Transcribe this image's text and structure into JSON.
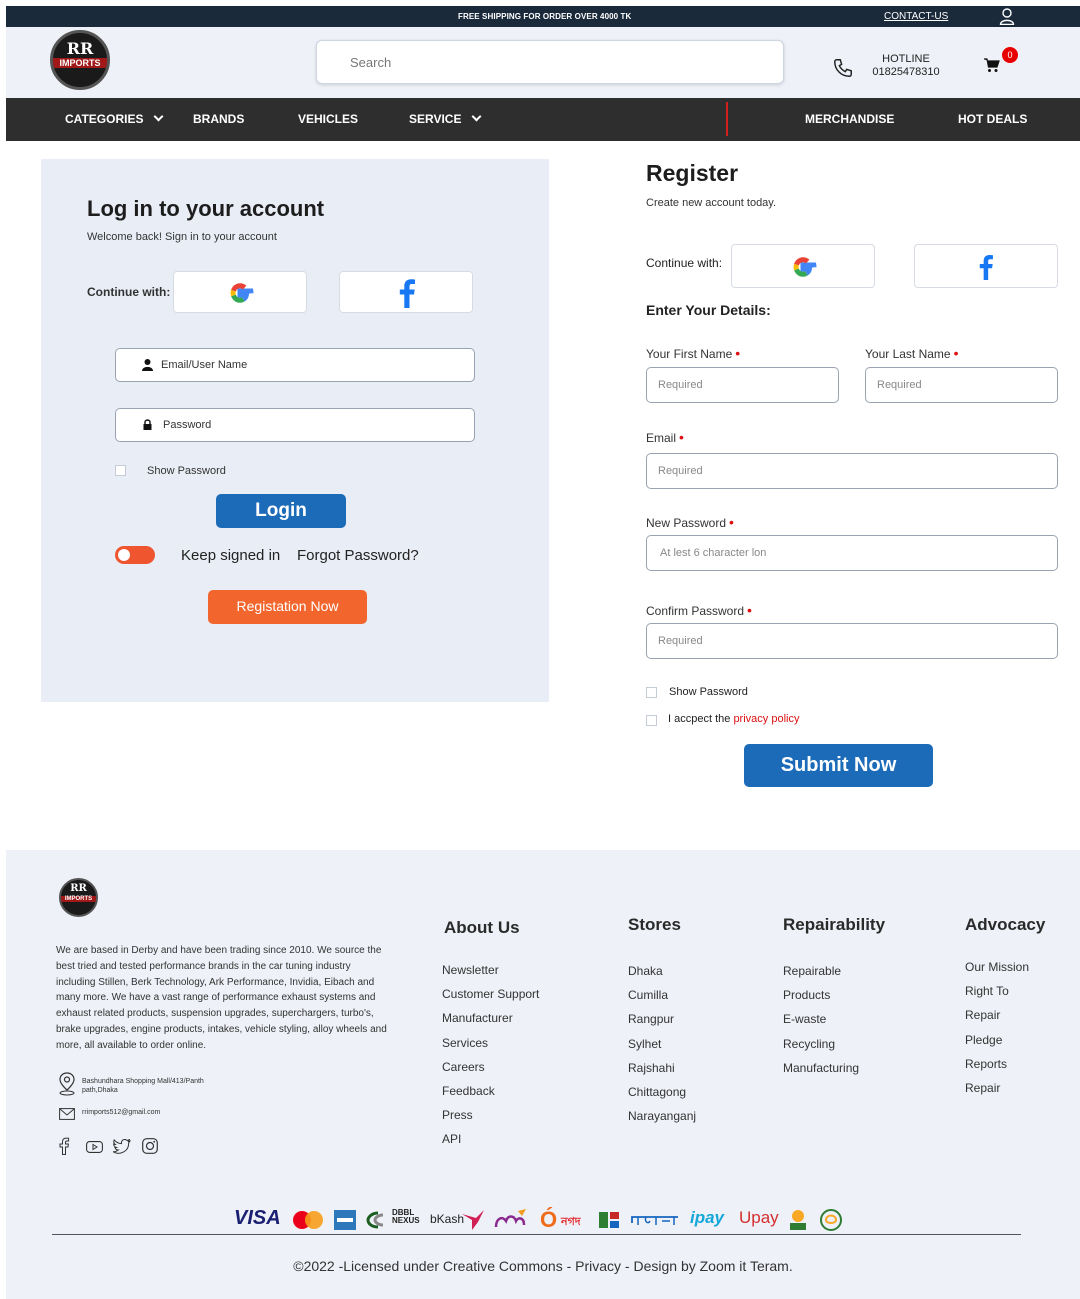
{
  "topbar": {
    "shipping": "FREE SHIPPING FOR ORDER OVER 4000 TK",
    "contact": "CONTACT-US"
  },
  "header": {
    "logo_text": "RR",
    "logo_word": "IMPORTS",
    "search_placeholder": "Search",
    "hotline_label": "HOTLINE",
    "hotline_number": "01825478310",
    "cart_count": "0"
  },
  "nav": {
    "categories": "CATEGORIES",
    "brands": "BRANDS",
    "vehicles": "VEHICLES",
    "service": "SERVICE",
    "merchandise": "MERCHANDISE",
    "hot_deals": "HOT DEALS"
  },
  "login": {
    "title": "Log in to your account",
    "subtitle": "Welcome back! Sign in to your account",
    "continue_with": "Continue with:",
    "email_placeholder": "Email/User Name",
    "password_placeholder": "Password",
    "show_password": "Show Password",
    "login_button": "Login",
    "keep_signed_in": "Keep signed in",
    "forgot_password": "Forgot Password?",
    "register_button": "Registation Now"
  },
  "register": {
    "title": "Register",
    "subtitle": "Create new account today.",
    "continue_with": "Continue with:",
    "details_heading": "Enter Your Details:",
    "first_name_label": "Your First Name",
    "last_name_label": "Your Last Name",
    "email_label": "Email",
    "new_password_label": "New Password",
    "confirm_password_label": "Confirm Password",
    "required_placeholder": "Required",
    "password_placeholder": "At lest 6 character lon",
    "show_password": "Show Password",
    "accept_text": "I accpect the",
    "privacy_link": "privacy policy",
    "submit_button": "Submit Now"
  },
  "footer": {
    "about_text": "We are based in Derby and have been trading since 2010. We source the best tried and tested performance brands in the car tuning industry including Stillen, Berk Technology, Ark Performance, Invidia, Eibach and many more. We have a vast range of performance exhaust systems and exhaust related products, suspension upgrades, superchargers, turbo's, brake upgrades, engine products, intakes, vehicle styling, alloy wheels and more, all available to order online.",
    "address": "Bashundhara Shopping Mall/413/Panth path,Dhaka",
    "email": "rrimports512@gmail.com",
    "columns": [
      {
        "title": "About Us",
        "items": [
          "Newsletter",
          "Customer Support",
          "Manufacturer",
          "Services",
          "Careers",
          "Feedback",
          "Press",
          "API"
        ]
      },
      {
        "title": "Stores",
        "items": [
          "Dhaka",
          "Cumilla",
          "Rangpur",
          "Sylhet",
          "Rajshahi",
          "Chittagong",
          "Narayanganj"
        ]
      },
      {
        "title": "Repairability",
        "items": [
          "Repairable",
          "Products",
          "E-waste",
          "Recycling",
          "Manufacturing"
        ]
      },
      {
        "title": "Advocacy",
        "items": [
          "Our Mission",
          "Right To",
          "Repair",
          "Pledge",
          "Reports",
          "Repair"
        ]
      }
    ],
    "payments": [
      "VISA",
      "DBBL NEXUS",
      "bKash",
      "নগদ",
      "ipay",
      "Upay"
    ],
    "copyright": "©2022 -Licensed under Creative Commons - Privacy - Design by Zoom it Teram."
  },
  "colors": {
    "topbar": "#1b2a3b",
    "nav": "#2e2e2e",
    "accent_blue": "#1c6bb8",
    "accent_orange": "#f2662e"
  }
}
